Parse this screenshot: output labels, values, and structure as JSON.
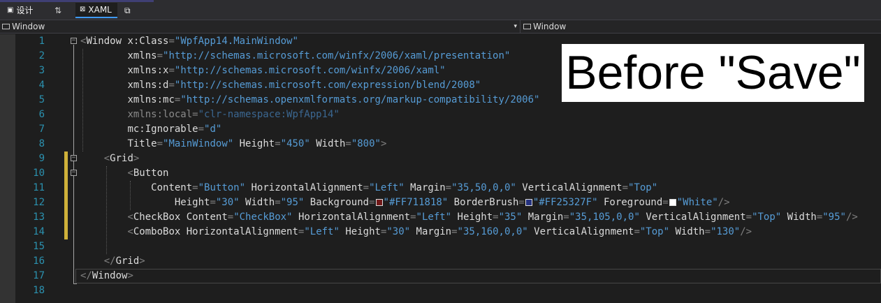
{
  "tabs": [
    {
      "label": "设计",
      "icon": "design-view-icon"
    },
    {
      "label": "⇅",
      "icon": "swap-panes-icon"
    },
    {
      "label": "XAML",
      "icon": "xaml-view-icon"
    },
    {
      "label": "",
      "icon": "popout-icon"
    }
  ],
  "navbar": {
    "left_label": "Window",
    "right_label": "Window"
  },
  "editor": {
    "line_numbers": [
      "1",
      "2",
      "3",
      "4",
      "5",
      "6",
      "7",
      "8",
      "9",
      "10",
      "11",
      "12",
      "13",
      "14",
      "15",
      "16",
      "17",
      "18"
    ]
  },
  "swatch_colors": {
    "background": "#711818",
    "border_brush": "#25327F",
    "foreground": "#FFFFFF"
  },
  "overlay": {
    "caption": "Before \"Save\""
  }
}
